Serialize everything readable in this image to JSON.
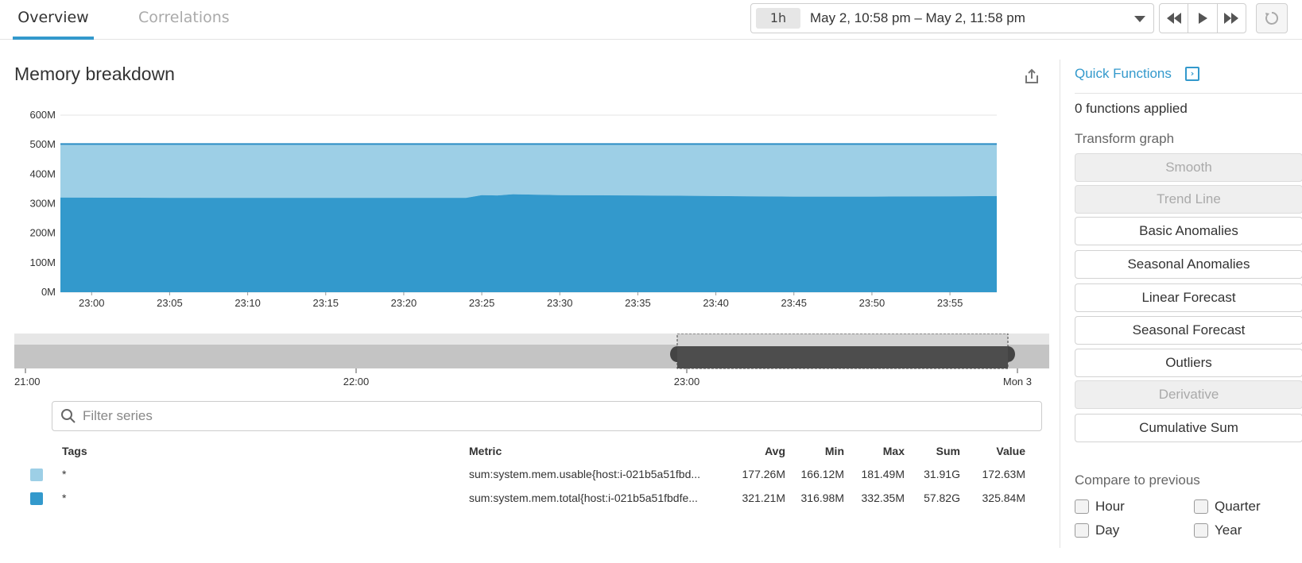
{
  "tabs": [
    {
      "label": "Overview",
      "active": true
    },
    {
      "label": "Correlations",
      "active": false
    }
  ],
  "timepicker": {
    "badge": "1h",
    "range": "May 2, 10:58 pm – May 2, 11:58 pm"
  },
  "playback": {
    "icons": [
      "rewind-icon",
      "play-icon",
      "fast-forward-icon"
    ],
    "reset_icon": "reset-icon"
  },
  "graph": {
    "title": "Memory breakdown",
    "share_icon": "share-icon"
  },
  "chart_data": {
    "type": "area",
    "title": "Memory breakdown",
    "y_tick_labels": [
      "0M",
      "100M",
      "200M",
      "300M",
      "400M",
      "500M",
      "600M"
    ],
    "ylim": [
      0,
      600
    ],
    "y_unit": "M",
    "x_tick_labels": [
      "23:00",
      "23:05",
      "23:10",
      "23:15",
      "23:20",
      "23:25",
      "23:30",
      "23:35",
      "23:40",
      "23:45",
      "23:50",
      "23:55"
    ],
    "x_minutes": [
      0,
      5,
      10,
      15,
      20,
      25,
      30,
      35,
      40,
      45,
      50,
      55
    ],
    "xlim_minutes": [
      -2,
      58
    ],
    "stacked": true,
    "series": [
      {
        "label": "sum:system.mem.total{host:i-021b5a51fbdfe...",
        "color": "#3399cc",
        "points": [
          [
            -2,
            321
          ],
          [
            5,
            320
          ],
          [
            10,
            320
          ],
          [
            15,
            320
          ],
          [
            20,
            320
          ],
          [
            24,
            320
          ],
          [
            25,
            329
          ],
          [
            26,
            328
          ],
          [
            27,
            332
          ],
          [
            28,
            331
          ],
          [
            30,
            329
          ],
          [
            35,
            328
          ],
          [
            40,
            326
          ],
          [
            45,
            324
          ],
          [
            50,
            324
          ],
          [
            55,
            325
          ],
          [
            58,
            325.8
          ]
        ]
      },
      {
        "label": "sum:system.mem.usable{host:i-021b5a51fbd...",
        "color": "#9dcfe6",
        "points": [
          [
            -2,
            180
          ],
          [
            5,
            181
          ],
          [
            10,
            181
          ],
          [
            15,
            181
          ],
          [
            20,
            181
          ],
          [
            24,
            181
          ],
          [
            25,
            172
          ],
          [
            26,
            173
          ],
          [
            27,
            169
          ],
          [
            28,
            170
          ],
          [
            30,
            172
          ],
          [
            35,
            173
          ],
          [
            40,
            175
          ],
          [
            45,
            177
          ],
          [
            50,
            177
          ],
          [
            55,
            176
          ],
          [
            58,
            175.2
          ]
        ]
      }
    ],
    "top_line_value": 502,
    "grid": true
  },
  "navigator": {
    "tick_labels": [
      "21:00",
      "22:00",
      "23:00",
      "Mon 3"
    ]
  },
  "filter": {
    "placeholder": "Filter series",
    "value": ""
  },
  "legend": {
    "headers": {
      "tags": "Tags",
      "metric": "Metric",
      "avg": "Avg",
      "min": "Min",
      "max": "Max",
      "sum": "Sum",
      "value": "Value"
    },
    "rows": [
      {
        "color": "#9dcfe6",
        "tags": "*",
        "metric": "sum:system.mem.usable{host:i-021b5a51fbd...",
        "avg": "177.26M",
        "min": "166.12M",
        "max": "181.49M",
        "sum": "31.91G",
        "value": "172.63M"
      },
      {
        "color": "#3399cc",
        "tags": "*",
        "metric": "sum:system.mem.total{host:i-021b5a51fbdfe...",
        "avg": "321.21M",
        "min": "316.98M",
        "max": "332.35M",
        "sum": "57.82G",
        "value": "325.84M"
      }
    ]
  },
  "sidebar": {
    "title": "Quick Functions",
    "applied": "0 functions applied",
    "transform_label": "Transform graph",
    "functions": [
      {
        "label": "Smooth",
        "disabled": true
      },
      {
        "label": "Trend Line",
        "disabled": true
      },
      {
        "label": "Basic Anomalies",
        "disabled": false
      },
      {
        "label": "Seasonal Anomalies",
        "disabled": false
      },
      {
        "label": "Linear Forecast",
        "disabled": false
      },
      {
        "label": "Seasonal Forecast",
        "disabled": false
      },
      {
        "label": "Outliers",
        "disabled": false
      },
      {
        "label": "Derivative",
        "disabled": true
      },
      {
        "label": "Cumulative Sum",
        "disabled": false
      }
    ],
    "compare_label": "Compare to previous",
    "compare_options": [
      {
        "label": "Hour",
        "checked": false
      },
      {
        "label": "Quarter",
        "checked": false
      },
      {
        "label": "Day",
        "checked": false
      },
      {
        "label": "Year",
        "checked": false
      }
    ]
  }
}
